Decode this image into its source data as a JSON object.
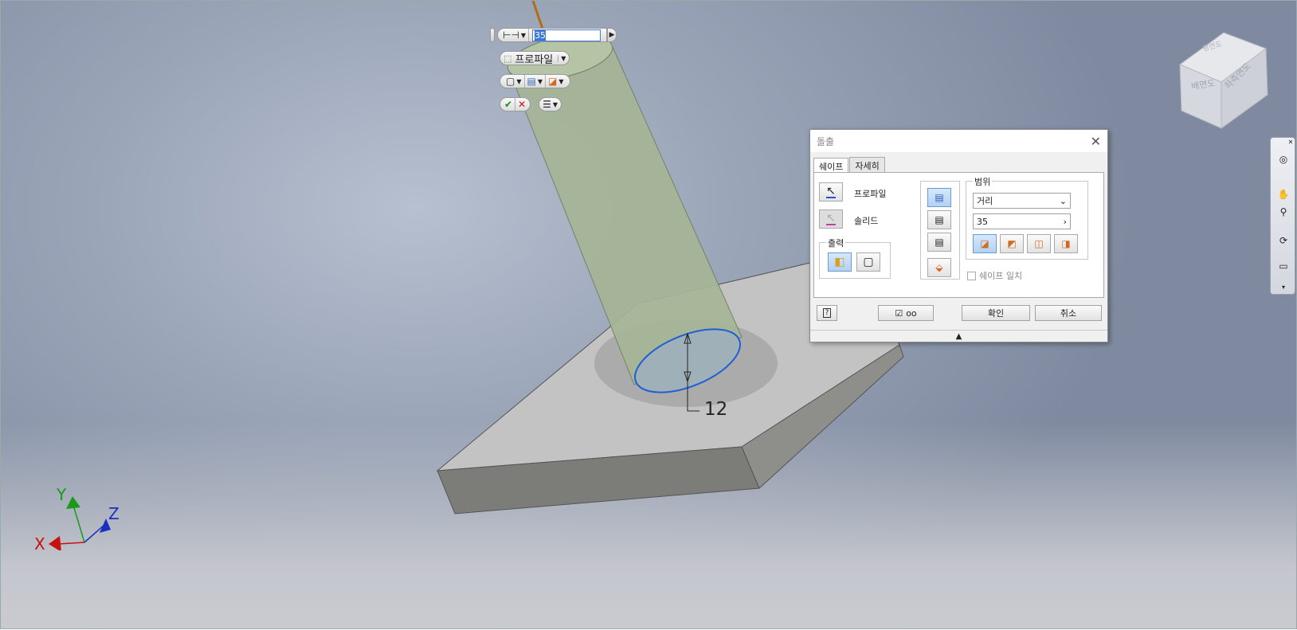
{
  "mini_toolbar": {
    "distance_value": "35",
    "profile_label": "프로파일"
  },
  "dialog": {
    "title": "돌출",
    "tabs": [
      "쉐이프",
      "자세히"
    ],
    "profile_label": "프로파일",
    "solid_label": "솔리드",
    "output_label": "출력",
    "extents_label": "범위",
    "extents_type": "거리",
    "distance_value": "35",
    "match_shape_label": "쉐이프 일치",
    "ok_label": "확인",
    "cancel_label": "취소"
  },
  "viewcube": {
    "faces": [
      "배면도",
      "좌측면도",
      "평면도"
    ]
  },
  "dimension": {
    "value": "12"
  },
  "triad": {
    "x": "X",
    "y": "Y",
    "z": "Z"
  },
  "colors": {
    "accent": "#3b79d6",
    "profile_edge": "#1f5fd4",
    "cylinder_fill": "#a8b89a",
    "plate_top": "#c4c4c4",
    "axis_x": "#c81010",
    "axis_y": "#1a9a1a",
    "axis_z": "#1b2fc0"
  }
}
